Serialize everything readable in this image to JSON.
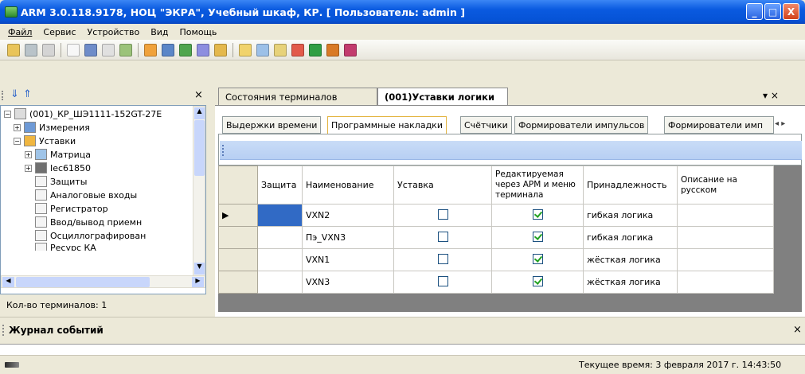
{
  "window": {
    "title": "ARM 3.0.118.9178, НОЦ \"ЭКРА\", Учебный шкаф, КР. [ Пользователь: admin ]",
    "minimize": "_",
    "maximize": "□",
    "close": "X"
  },
  "menu": [
    "Файл",
    "Сервис",
    "Устройство",
    "Вид",
    "Помощь"
  ],
  "left_panel": {
    "close": "×",
    "tree": [
      {
        "label": "(001)_КР_ШЭ1111-152GT-27Е",
        "expander": "−"
      },
      {
        "label": "Измерения",
        "expander": "+"
      },
      {
        "label": "Уставки",
        "expander": "−"
      },
      {
        "label": "Матрица",
        "expander": "+"
      },
      {
        "label": "Iec61850",
        "expander": "+"
      },
      {
        "label": "Защиты",
        "expander": ""
      },
      {
        "label": "Аналоговые входы",
        "expander": ""
      },
      {
        "label": "Регистратор",
        "expander": ""
      },
      {
        "label": "Ввод/вывод приемн",
        "expander": ""
      },
      {
        "label": "Осциллографирован",
        "expander": ""
      },
      {
        "label": "Ресурс КА",
        "expander": ""
      }
    ],
    "footer": "Кол-во терминалов: 1"
  },
  "doc_tabs": [
    "Состояния терминалов",
    "(001)Уставки логики"
  ],
  "doc_tabs_menu": "▾ ×",
  "sub_tabs": [
    "Выдержки времени",
    "Программные накладки",
    "Счётчики",
    "Формирователи импульсов",
    "Формирователи имп"
  ],
  "sub_tabs_nav": "◂ ▸",
  "grid": {
    "columns": [
      "Защита",
      "Наименование",
      "Уставка",
      "Редактируемая через АРМ и меню терминала",
      "Принадлежность",
      "Описание на русском"
    ],
    "rows": [
      {
        "name": "VXN2",
        "setting": false,
        "editable": true,
        "owner": "гибкая логика",
        "desc": ""
      },
      {
        "name": "Пэ_VXN3",
        "setting": false,
        "editable": true,
        "owner": "гибкая логика",
        "desc": ""
      },
      {
        "name": "VXN1",
        "setting": false,
        "editable": true,
        "owner": "жёсткая логика",
        "desc": ""
      },
      {
        "name": "VXN3",
        "setting": false,
        "editable": true,
        "owner": "жёсткая логика",
        "desc": ""
      }
    ],
    "current_row_marker": "▶"
  },
  "events_panel": {
    "title": "Журнал событий",
    "close": "×"
  },
  "status": {
    "time": "Текущее время: 3 февраля 2017 г. 14:43:50"
  }
}
